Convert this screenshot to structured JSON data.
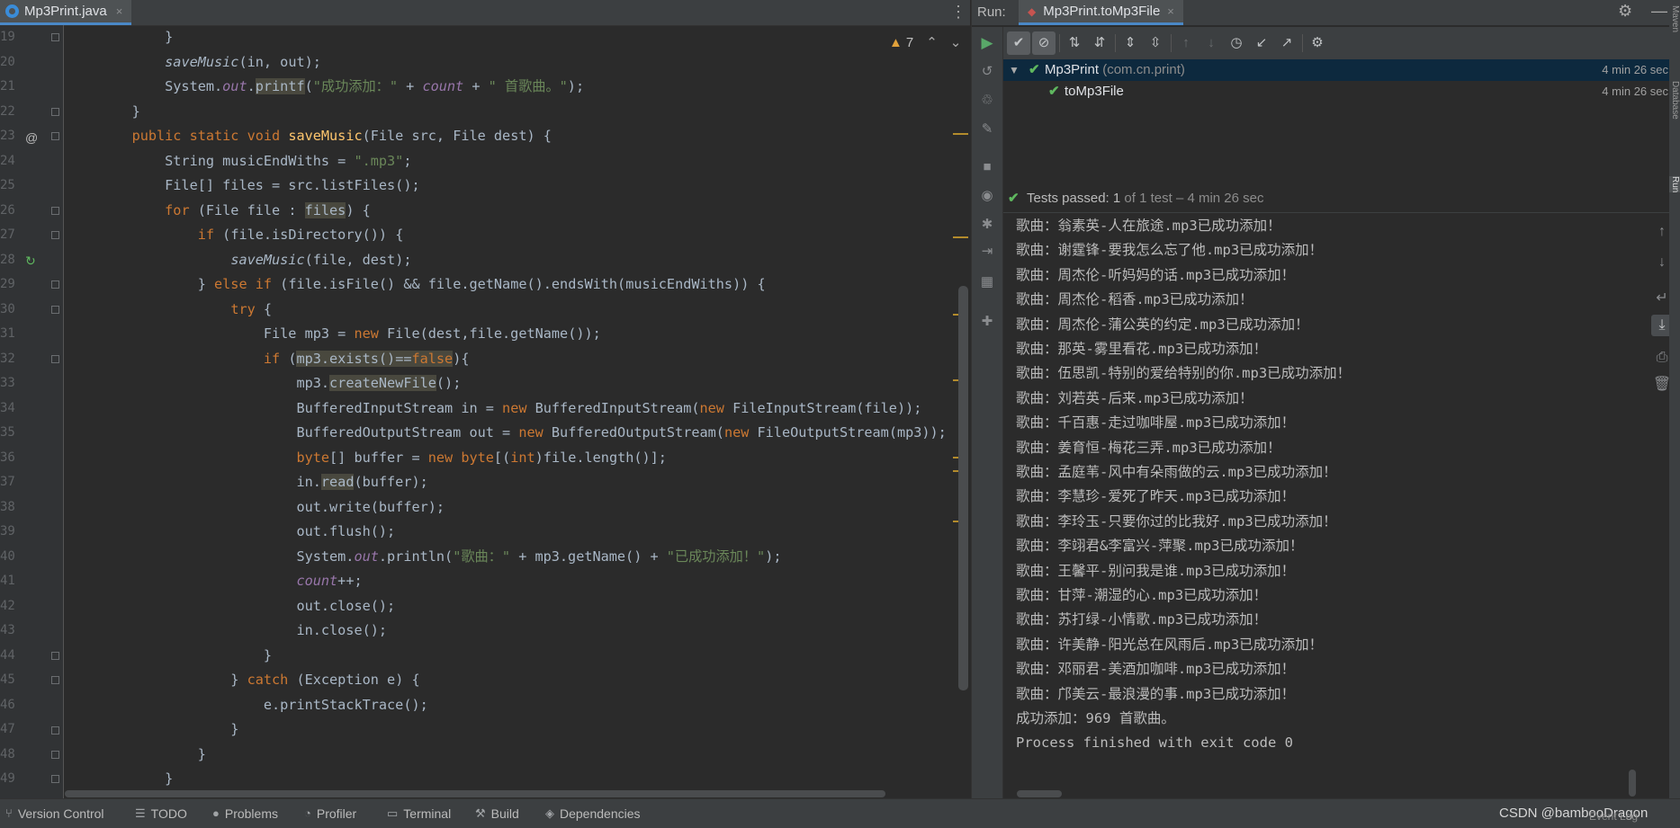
{
  "editor": {
    "file_tab": "Mp3Print.java",
    "close_glyph": "×",
    "kebab": "⋮",
    "inspection_count": "7",
    "line_numbers": [
      "19",
      "20",
      "21",
      "22",
      "23",
      "24",
      "25",
      "26",
      "27",
      "28",
      "29",
      "30",
      "31",
      "32",
      "33",
      "34",
      "35",
      "36",
      "37",
      "38",
      "39",
      "40",
      "41",
      "42",
      "43",
      "44",
      "45",
      "46",
      "47",
      "48",
      "49"
    ]
  },
  "run": {
    "label": "Run:",
    "tab": "Mp3Print.toMp3File",
    "tree": [
      {
        "name": "Mp3Print",
        "package": "(com.cn.print)",
        "time": "4 min 26 sec"
      },
      {
        "name": "toMp3File",
        "package": "",
        "time": "4 min 26 sec"
      }
    ],
    "status": {
      "prefix": "Tests passed:",
      "count": "1",
      "suffix": "of 1 test – 4 min 26 sec"
    },
    "console": [
      "歌曲：翁素英-人在旅途.mp3已成功添加！",
      "歌曲：谢霆锋-要我怎么忘了他.mp3已成功添加！",
      "歌曲：周杰伦-听妈妈的话.mp3已成功添加！",
      "歌曲：周杰伦-稻香.mp3已成功添加！",
      "歌曲：周杰伦-蒲公英的约定.mp3已成功添加！",
      "歌曲：那英-雾里看花.mp3已成功添加！",
      "歌曲：伍思凯-特别的爱给特别的你.mp3已成功添加！",
      "歌曲：刘若英-后来.mp3已成功添加！",
      "歌曲：千百惠-走过咖啡屋.mp3已成功添加！",
      "歌曲：姜育恒-梅花三弄.mp3已成功添加！",
      "歌曲：孟庭苇-风中有朵雨做的云.mp3已成功添加！",
      "歌曲：李慧珍-爱死了昨天.mp3已成功添加！",
      "歌曲：李玲玉-只要你过的比我好.mp3已成功添加！",
      "歌曲：李翊君&李富兴-萍聚.mp3已成功添加！",
      "歌曲：王馨平-别问我是谁.mp3已成功添加！",
      "歌曲：甘萍-潮湿的心.mp3已成功添加！",
      "歌曲：苏打绿-小情歌.mp3已成功添加！",
      "歌曲：许美静-阳光总在风雨后.mp3已成功添加！",
      "歌曲：邓丽君-美酒加咖啡.mp3已成功添加！",
      "歌曲：邝美云-最浪漫的事.mp3已成功添加！",
      "成功添加：969 首歌曲。",
      "Process finished with exit code 0"
    ]
  },
  "statusbar": {
    "items": [
      "Version Control",
      "TODO",
      "Problems",
      "Profiler",
      "Terminal",
      "Build",
      "Dependencies"
    ],
    "watermark": "CSDN @bambooDragon",
    "event_log": "Event Log"
  },
  "right_strip": {
    "top_label": "Maven",
    "mid_label": "Database",
    "bottom_label": "Run"
  },
  "colors": {
    "keyword": "#cc7832",
    "string": "#6a8759",
    "static_field": "#9876aa",
    "method_decl": "#ffc66d",
    "pass_green": "#5fb85f",
    "selection": "#0d293e"
  }
}
